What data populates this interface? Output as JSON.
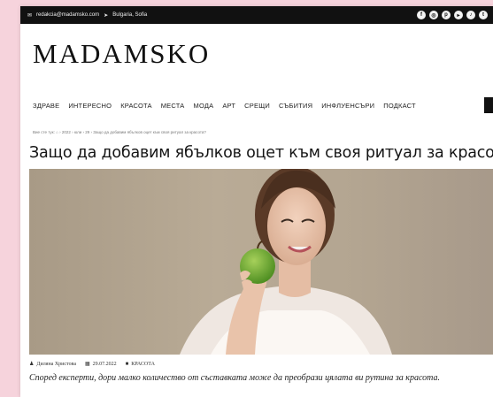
{
  "topbar": {
    "email": "redakcia@madamsko.com",
    "location": "Bulgaria, Sofia",
    "social_icons": [
      "facebook-icon",
      "instagram-icon",
      "pinterest-icon",
      "youtube-icon",
      "tiktok-icon",
      "twitter-icon"
    ]
  },
  "site": {
    "logo": "MADAMSKO"
  },
  "nav": {
    "items": [
      "ЗДРАВЕ",
      "ИНТЕРЕСНО",
      "КРАСОТА",
      "МЕСТА",
      "МОДА",
      "АРТ",
      "СРЕЩИ",
      "СЪБИТИЯ",
      "ИНФЛУЕНСЪРИ",
      "ПОДКАСТ"
    ]
  },
  "breadcrumb": {
    "text": "Вие сте тук: ⌂ › 2022 › юли › 29 › Защо да добавим ябълков оцет към своя ритуал за красота?"
  },
  "article": {
    "title": "Защо да добавим ябълков оцет към своя ритуал за красота?",
    "author": "Диляна Христова",
    "date": "29.07.2022",
    "category": "КРАСОТА",
    "lead": "Според експерти, дори малко количество от съставката може да преобрази цялата ви рутина за красота."
  },
  "colors": {
    "background": "#f6d3dc",
    "topbar": "#111111",
    "hero_bg": "#b3a591",
    "apple": "#6fae3a"
  }
}
